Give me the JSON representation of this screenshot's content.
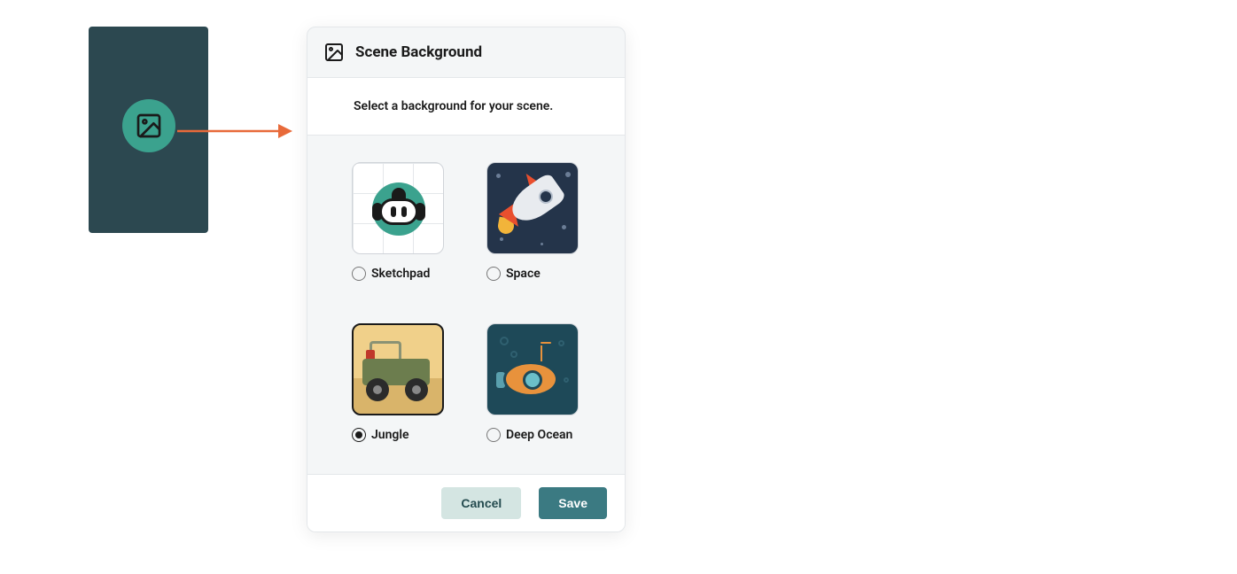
{
  "stage": {
    "icon": "image-icon"
  },
  "dialog": {
    "title": "Scene Background",
    "instruction": "Select a background for your scene.",
    "options": [
      {
        "id": "sketchpad",
        "label": "Sketchpad",
        "selected": false
      },
      {
        "id": "space",
        "label": "Space",
        "selected": false
      },
      {
        "id": "jungle",
        "label": "Jungle",
        "selected": true
      },
      {
        "id": "deep-ocean",
        "label": "Deep Ocean",
        "selected": false
      }
    ],
    "footer": {
      "cancel_label": "Cancel",
      "save_label": "Save"
    }
  },
  "colors": {
    "stage_bg": "#2c4850",
    "accent_teal": "#3ba28e",
    "arrow": "#e86a3a",
    "save_btn": "#3b7a82",
    "cancel_btn": "#d4e5e2"
  }
}
